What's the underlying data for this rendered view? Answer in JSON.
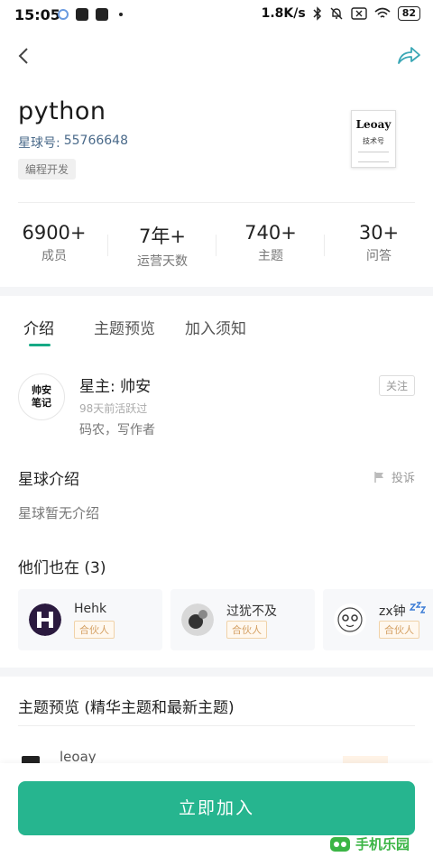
{
  "status_bar": {
    "time": "15:05",
    "speed": "1.8K/s",
    "battery": "82"
  },
  "header": {
    "title": "python",
    "star_id_label": "星球号:",
    "star_id_value": "55766648",
    "tag": "编程开发",
    "logo_brand": "Leoay",
    "logo_sub": "技术号"
  },
  "stats": [
    {
      "value": "6900+",
      "label": "成员"
    },
    {
      "value": "7年+",
      "label": "运营天数"
    },
    {
      "value": "740+",
      "label": "主题"
    },
    {
      "value": "30+",
      "label": "问答"
    }
  ],
  "tabs": [
    {
      "label": "介绍",
      "active": true
    },
    {
      "label": "主题预览",
      "active": false
    },
    {
      "label": "加入须知",
      "active": false
    }
  ],
  "owner": {
    "avatar_text_1": "帅安",
    "avatar_text_2": "笔记",
    "name": "星主: 帅安",
    "active": "98天前活跃过",
    "desc": "码农，写作者",
    "follow_label": "关注"
  },
  "intro": {
    "title": "星球介绍",
    "report_label": "投诉",
    "text": "星球暂无介绍"
  },
  "partners": {
    "title": "他们也在 (3)",
    "items": [
      {
        "name": "Hehk",
        "badge": "合伙人"
      },
      {
        "name": "过犹不及",
        "badge": "合伙人"
      },
      {
        "name": "zx钟",
        "badge": "合伙人"
      }
    ]
  },
  "preview": {
    "title": "主题预览 (精华主题和最新主题)",
    "first_author": "leoay"
  },
  "bottom": {
    "join_label": "立即加入",
    "watermark": "手机乐园"
  },
  "colors": {
    "accent": "#26b58f",
    "badge": "#d4a063"
  }
}
